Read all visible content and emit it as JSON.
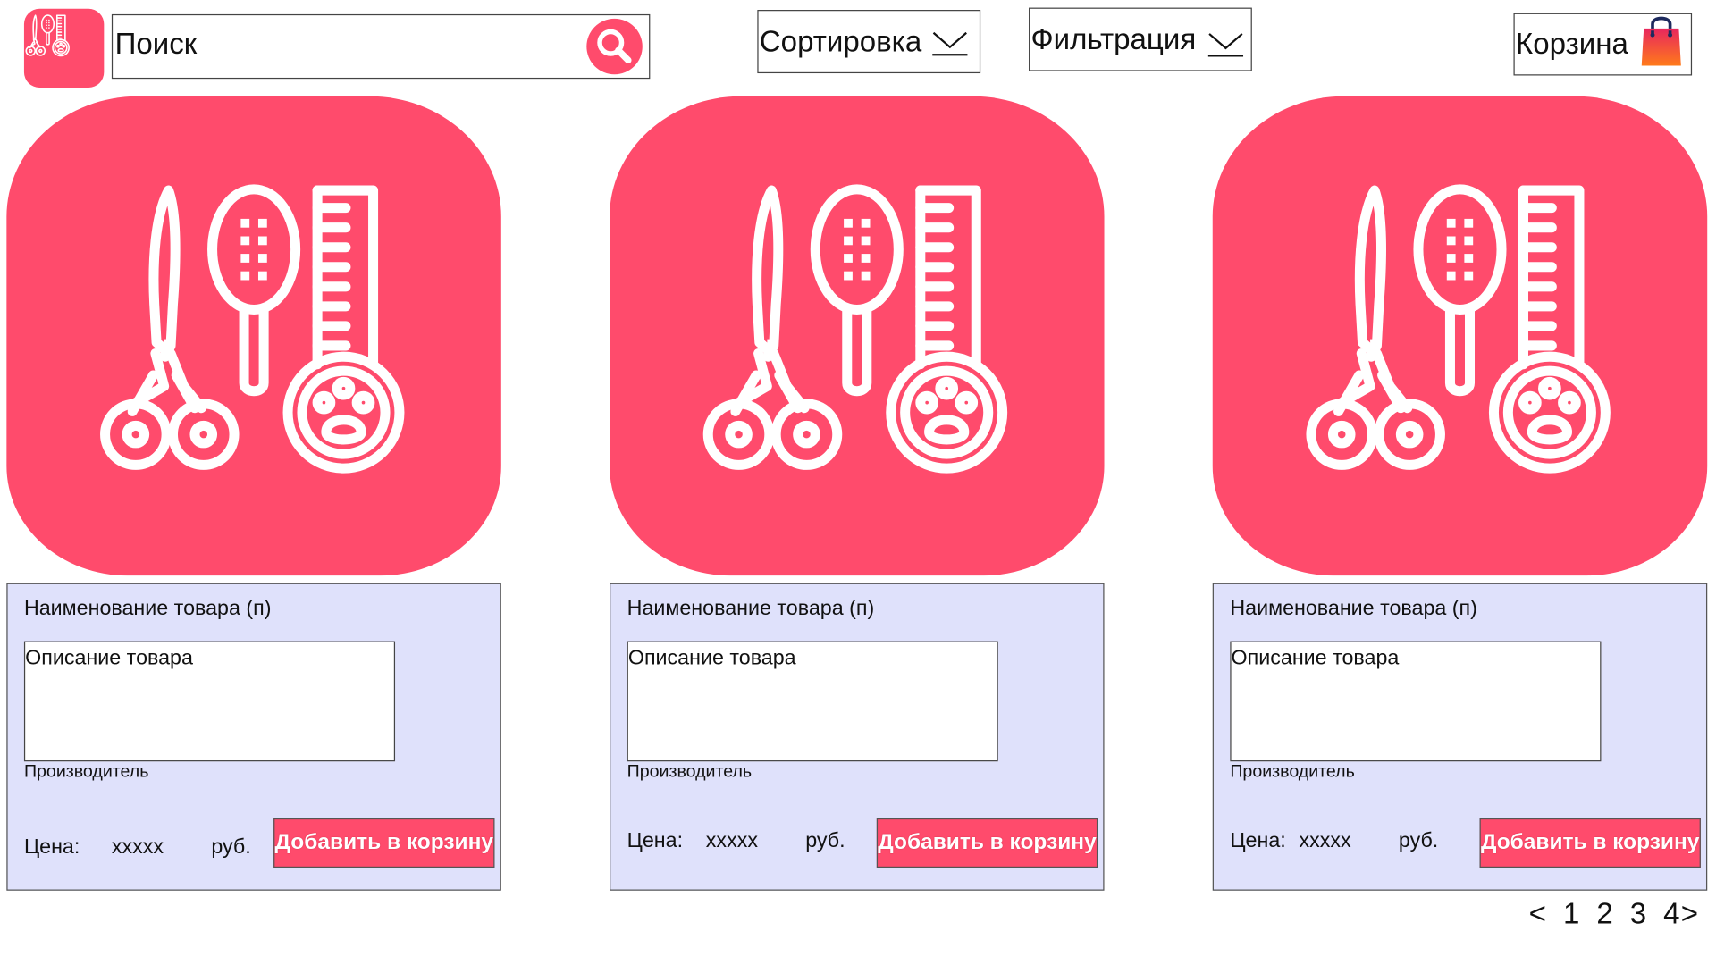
{
  "header": {
    "logo_icon": "grooming-tools-icon",
    "search": {
      "value": "Поиск",
      "icon": "search-icon"
    },
    "sort": {
      "label": "Сортировка",
      "icon": "chevron-down-icon"
    },
    "filter": {
      "label": "Фильтрация",
      "icon": "chevron-down-icon"
    },
    "cart": {
      "label": "Корзина",
      "icon": "shopping-bag-icon"
    }
  },
  "colors": {
    "accent": "#ff4b6c",
    "card_info_bg": "#dfe1fb"
  },
  "products": [
    {
      "image_icon": "grooming-tools-icon",
      "name": "Наименование товара (п)",
      "description": "Описание товара",
      "manufacturer": "Производитель",
      "price_label": "Цена:",
      "price": "xxxxx",
      "currency": "руб.",
      "add_to_cart": "Добавить в корзину"
    },
    {
      "image_icon": "grooming-tools-icon",
      "name": "Наименование товара (п)",
      "description": "Описание товара",
      "manufacturer": "Производитель",
      "price_label": "Цена:",
      "price": "xxxxx",
      "currency": "руб.",
      "add_to_cart": "Добавить в корзину"
    },
    {
      "image_icon": "grooming-tools-icon",
      "name": "Наименование товара (п)",
      "description": "Описание товара",
      "manufacturer": "Производитель",
      "price_label": "Цена:",
      "price": "xxxxx",
      "currency": "руб.",
      "add_to_cart": "Добавить в корзину"
    }
  ],
  "pagination": {
    "prev": "<",
    "pages": [
      "1",
      "2",
      "3",
      "4"
    ],
    "next": ">"
  }
}
